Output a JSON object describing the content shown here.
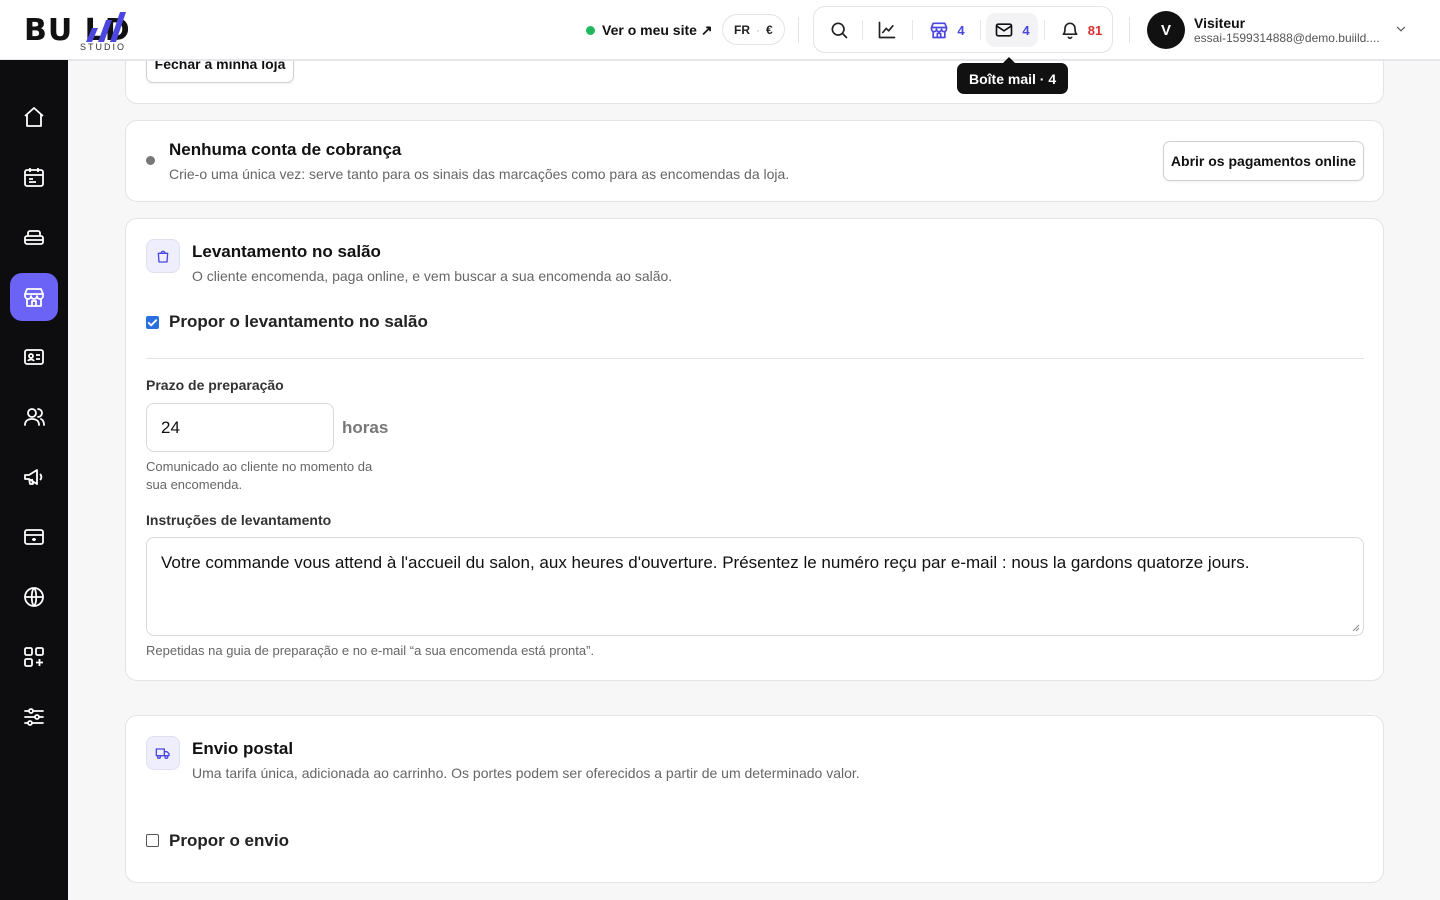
{
  "header": {
    "logo_main": "BU LD",
    "logo_sub": "STUDIO",
    "site_link": "Ver o meu site ↗",
    "lang": "FR",
    "currency": "€",
    "shop_count": "4",
    "mail_count": "4",
    "notif_count": "81",
    "tooltip": "Boîte mail · 4",
    "user": {
      "initial": "V",
      "name": "Visiteur",
      "email": "essai-1599314888@demo.buiild...."
    }
  },
  "sidebar": {
    "items": [
      {
        "icon": "home-icon"
      },
      {
        "icon": "calendar-icon"
      },
      {
        "icon": "services-icon"
      },
      {
        "icon": "store-icon",
        "active": true
      },
      {
        "icon": "contact-card-icon"
      },
      {
        "icon": "users-icon"
      },
      {
        "icon": "megaphone-icon"
      },
      {
        "icon": "payment-card-icon"
      },
      {
        "icon": "globe-icon"
      },
      {
        "icon": "apps-icon"
      },
      {
        "icon": "sliders-icon"
      }
    ]
  },
  "shop_card": {
    "close_button": "Fechar a minha loja"
  },
  "billing": {
    "title": "Nenhuma conta de cobrança",
    "description": "Crie-o uma única vez: serve tanto para os sinais das marcações como para as encomendas da loja.",
    "button": "Abrir os pagamentos online"
  },
  "pickup": {
    "title": "Levantamento no salão",
    "description": "O cliente encomenda, paga online, e vem buscar a sua encomenda ao salão.",
    "checkbox_label": "Propor o levantamento no salão",
    "checked": true,
    "prep_label": "Prazo de preparação",
    "prep_value": "24",
    "prep_unit": "horas",
    "prep_hint": "Comunicado ao cliente no momento da sua encomenda.",
    "instructions_label": "Instruções de levantamento",
    "instructions_value": "Votre commande vous attend à l'accueil du salon, aux heures d'ouverture. Présentez le numéro reçu par e-mail : nous la gardons quatorze jours.",
    "instructions_hint": "Repetidas na guia de preparação e no e-mail “a sua encomenda está pronta”."
  },
  "shipping": {
    "title": "Envio postal",
    "description": "Uma tarifa única, adicionada ao carrinho. Os portes podem ser oferecidos a partir de um determinado valor.",
    "checkbox_label": "Propor o envio",
    "checked": false
  },
  "colors": {
    "accent": "#6a63f5",
    "sidebar_bg": "#0d0d0f",
    "count_blue": "#4b46e0",
    "count_red": "#d93030",
    "online_dot": "#1fb85a"
  }
}
